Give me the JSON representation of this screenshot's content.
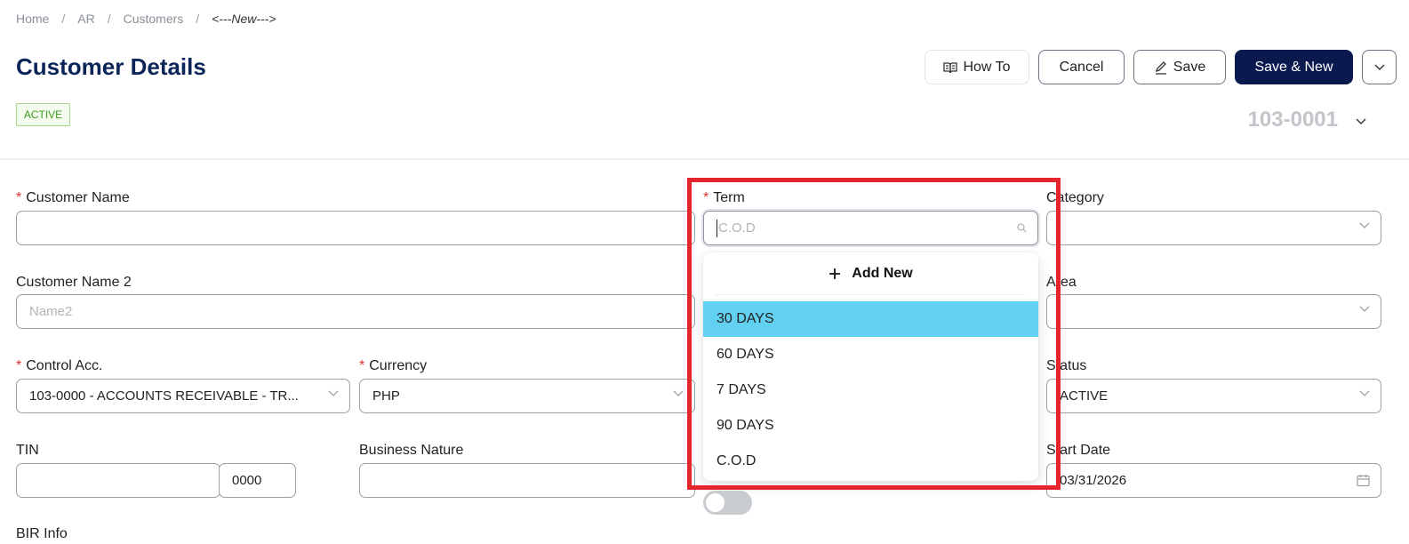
{
  "breadcrumb": {
    "items": [
      "Home",
      "AR",
      "Customers"
    ],
    "separator": "/",
    "current": "<---New--->"
  },
  "page_title": "Customer Details",
  "toolbar": {
    "howto": "How To",
    "cancel": "Cancel",
    "save": "Save",
    "save_new": "Save & New"
  },
  "status_badge": "ACTIVE",
  "doc_number": "103-0001",
  "form": {
    "customer_name": {
      "label": "Customer Name",
      "value": "",
      "required": true
    },
    "customer_name2": {
      "label": "Customer Name 2",
      "placeholder": "Name2"
    },
    "control_acc": {
      "label": "Control Acc.",
      "value": "103-0000 - ACCOUNTS RECEIVABLE - TR...",
      "required": true
    },
    "currency": {
      "label": "Currency",
      "value": "PHP",
      "required": true
    },
    "tin": {
      "label": "TIN",
      "value": "",
      "branch": "0000"
    },
    "business_nature": {
      "label": "Business Nature",
      "value": ""
    },
    "bir_info": {
      "label": "BIR Info"
    },
    "term": {
      "label": "Term",
      "placeholder": "C.O.D",
      "required": true
    },
    "category": {
      "label": "Category",
      "value": ""
    },
    "area": {
      "label": "Area",
      "value": ""
    },
    "status": {
      "label": "Status",
      "value": "ACTIVE"
    },
    "start_date": {
      "label": "Start Date",
      "value": "03/31/2026"
    }
  },
  "term_dropdown": {
    "add_new": "Add New",
    "options": [
      "30 DAYS",
      "60 DAYS",
      "7 DAYS",
      "90 DAYS",
      "C.O.D"
    ],
    "highlighted": "30 DAYS"
  },
  "colors": {
    "primary": "#0a1a4e",
    "title": "#0b2559",
    "highlight_option": "#62d0f0",
    "annotation": "#e5242b",
    "required": "#e03131"
  }
}
